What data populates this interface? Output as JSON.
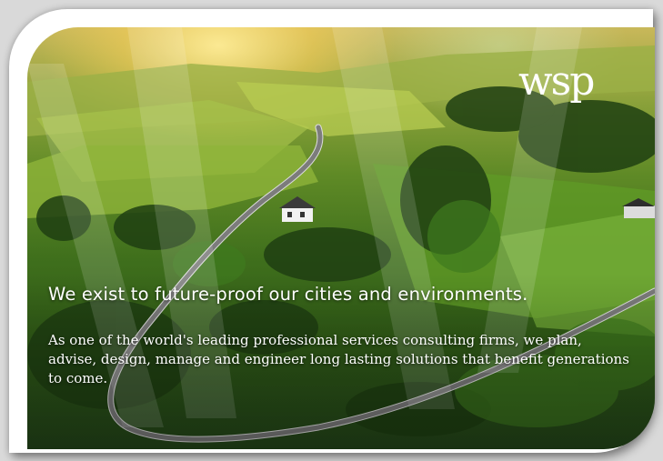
{
  "brand": {
    "logo_text": "wsp",
    "logo_color": "#ffffff"
  },
  "hero": {
    "headline": "We exist to future-proof our cities and environments.",
    "body": "As one of the world's leading professional services consulting firms, we plan, advise, design, manage and engineer long lasting solutions that benefit generations to come."
  },
  "colors": {
    "background": "#d9d9d9",
    "frame": "#ffffff",
    "text": "#ffffff"
  }
}
